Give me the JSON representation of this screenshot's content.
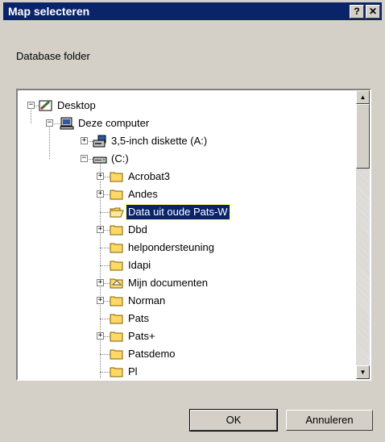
{
  "window": {
    "title": "Map selecteren",
    "help_btn": "?",
    "close_btn": "✕"
  },
  "prompt": "Database folder",
  "tree": [
    {
      "label": "Desktop",
      "level": 0,
      "expander": "−",
      "icon": "desktop-icon"
    },
    {
      "label": "Deze computer",
      "level": 1,
      "expander": "−",
      "icon": "computer-icon"
    },
    {
      "label": "3,5-inch diskette (A:)",
      "level": 2,
      "expander": "+",
      "icon": "floppy-icon"
    },
    {
      "label": "(C:)",
      "level": 2,
      "expander": "−",
      "icon": "drive-icon"
    },
    {
      "label": "Acrobat3",
      "level": 3,
      "expander": "+",
      "icon": "folder-icon"
    },
    {
      "label": "Andes",
      "level": 3,
      "expander": "+",
      "icon": "folder-icon"
    },
    {
      "label": "Data uit oude Pats-W",
      "level": 3,
      "expander": "",
      "icon": "folder-open-icon",
      "selected": true
    },
    {
      "label": "Dbd",
      "level": 3,
      "expander": "+",
      "icon": "folder-icon"
    },
    {
      "label": "helpondersteuning",
      "level": 3,
      "expander": "",
      "icon": "folder-icon"
    },
    {
      "label": "Idapi",
      "level": 3,
      "expander": "",
      "icon": "folder-icon"
    },
    {
      "label": "Mijn documenten",
      "level": 3,
      "expander": "+",
      "icon": "mydocs-icon"
    },
    {
      "label": "Norman",
      "level": 3,
      "expander": "+",
      "icon": "folder-icon"
    },
    {
      "label": "Pats",
      "level": 3,
      "expander": "",
      "icon": "folder-icon"
    },
    {
      "label": "Pats+",
      "level": 3,
      "expander": "+",
      "icon": "folder-icon"
    },
    {
      "label": "Patsdemo",
      "level": 3,
      "expander": "",
      "icon": "folder-icon"
    },
    {
      "label": "Pl",
      "level": 3,
      "expander": "",
      "icon": "folder-icon"
    }
  ],
  "buttons": {
    "ok": "OK",
    "cancel": "Annuleren"
  },
  "colors": {
    "titlebar": "#0a246a",
    "face": "#d4d0c8",
    "selection": "#0a246a",
    "folder": "#ffd966"
  }
}
